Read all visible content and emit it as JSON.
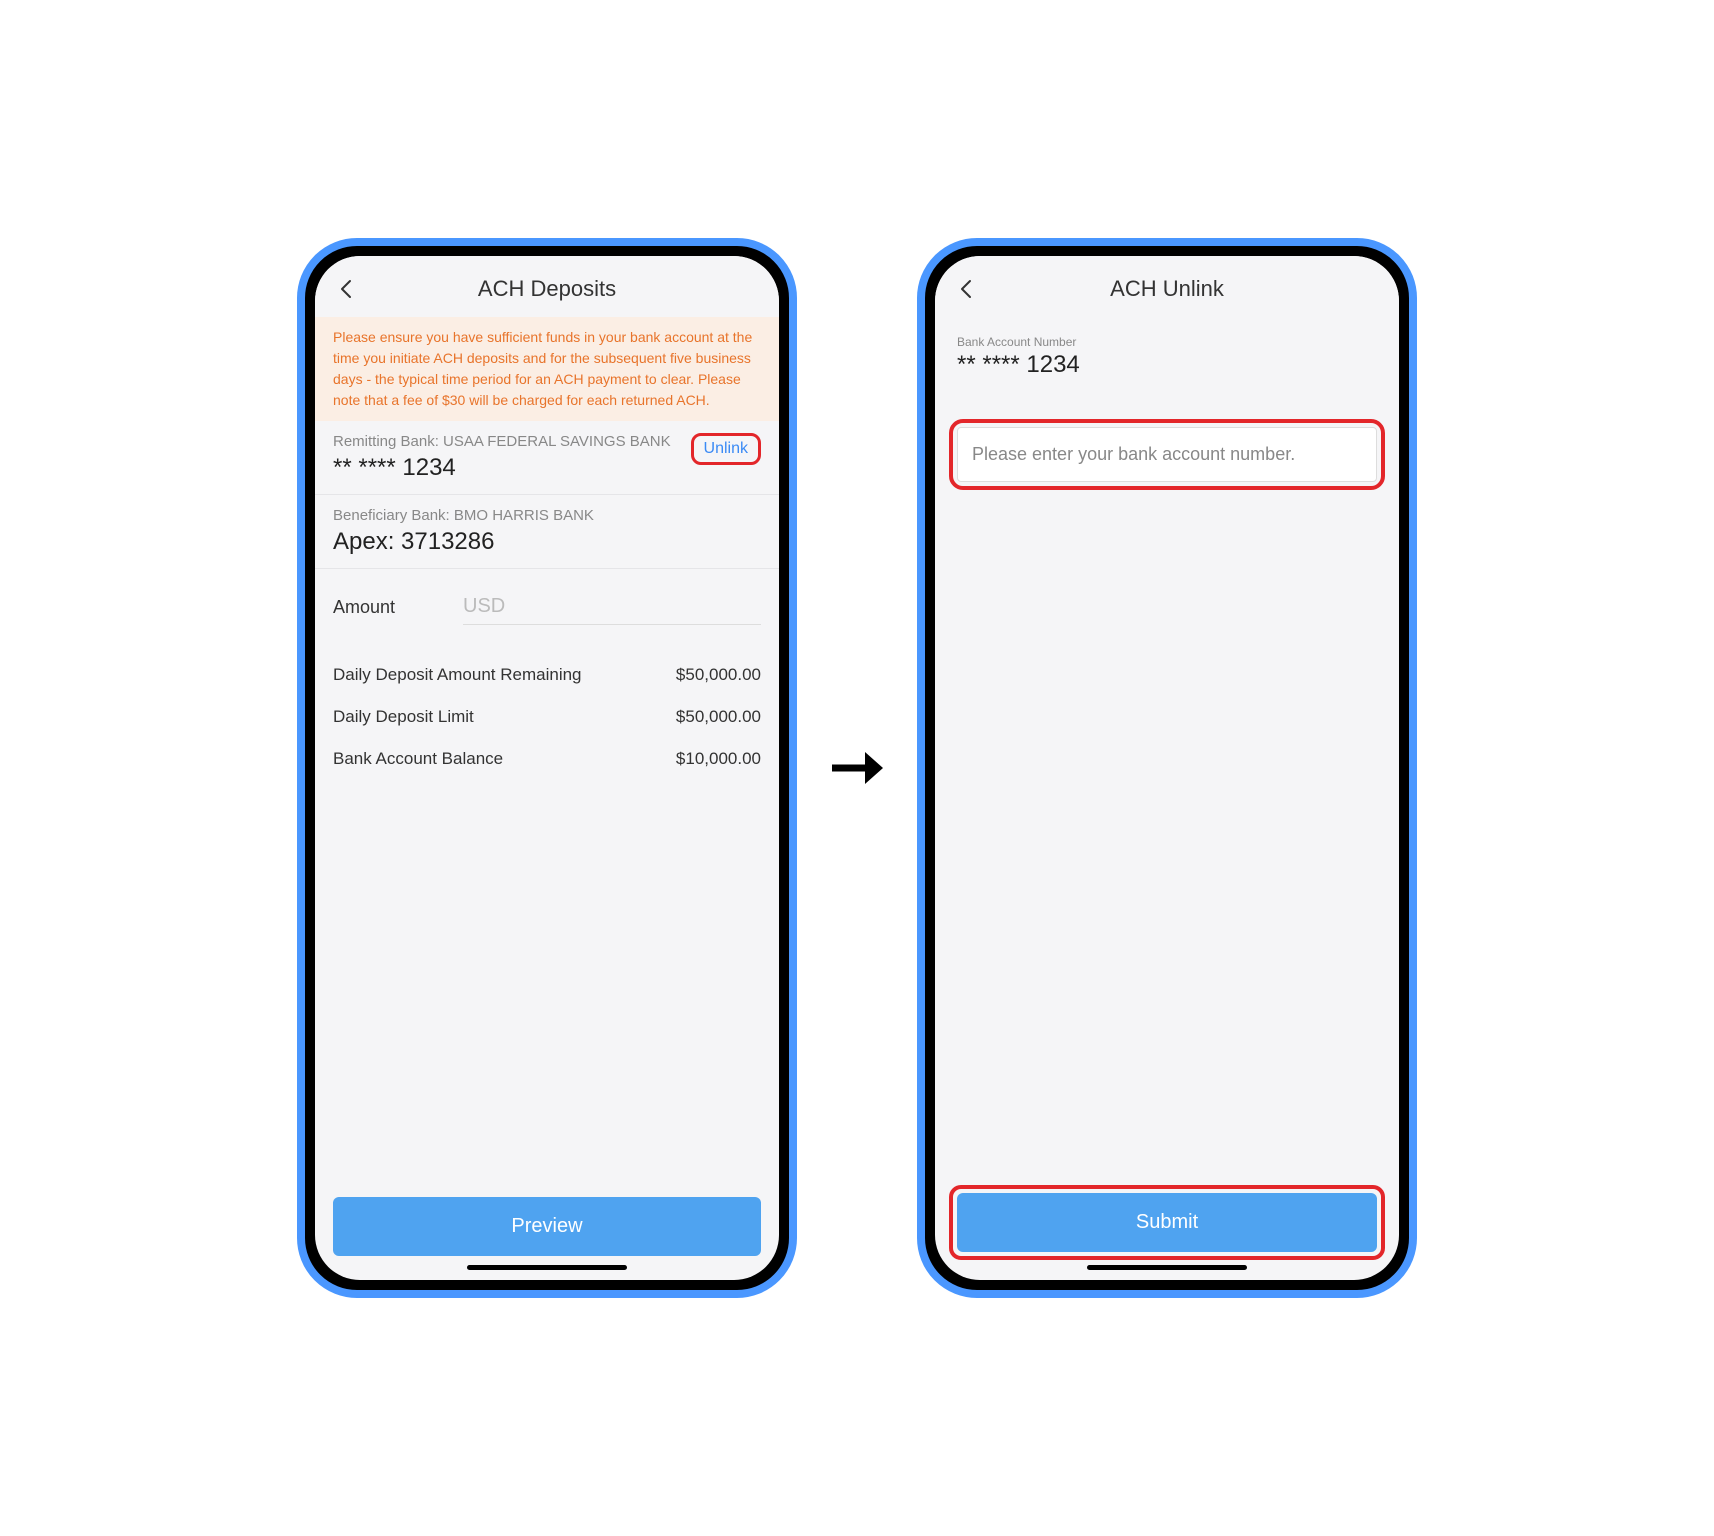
{
  "screen1": {
    "title": "ACH Deposits",
    "warning": "Please ensure you have sufficient funds in your bank account at the time you initiate ACH deposits and for the subsequent five business days - the typical time period for an ACH payment to clear. Please note that a fee of $30 will be charged for each returned ACH.",
    "remitting": {
      "label": "Remitting Bank: USAA FEDERAL SAVINGS BANK",
      "account": "** **** 1234",
      "unlink": "Unlink"
    },
    "beneficiary": {
      "label": "Beneficiary Bank: BMO HARRIS BANK",
      "apex": "Apex: 3713286"
    },
    "amount": {
      "label": "Amount",
      "placeholder": "USD"
    },
    "stats": [
      {
        "label": "Daily Deposit Amount Remaining",
        "value": "$50,000.00"
      },
      {
        "label": "Daily Deposit Limit",
        "value": "$50,000.00"
      },
      {
        "label": "Bank Account Balance",
        "value": "$10,000.00"
      }
    ],
    "preview_button": "Preview"
  },
  "screen2": {
    "title": "ACH Unlink",
    "account_label": "Bank Account Number",
    "account_masked": "** **** 1234",
    "input_placeholder": "Please enter your bank account number.",
    "submit_button": "Submit"
  }
}
